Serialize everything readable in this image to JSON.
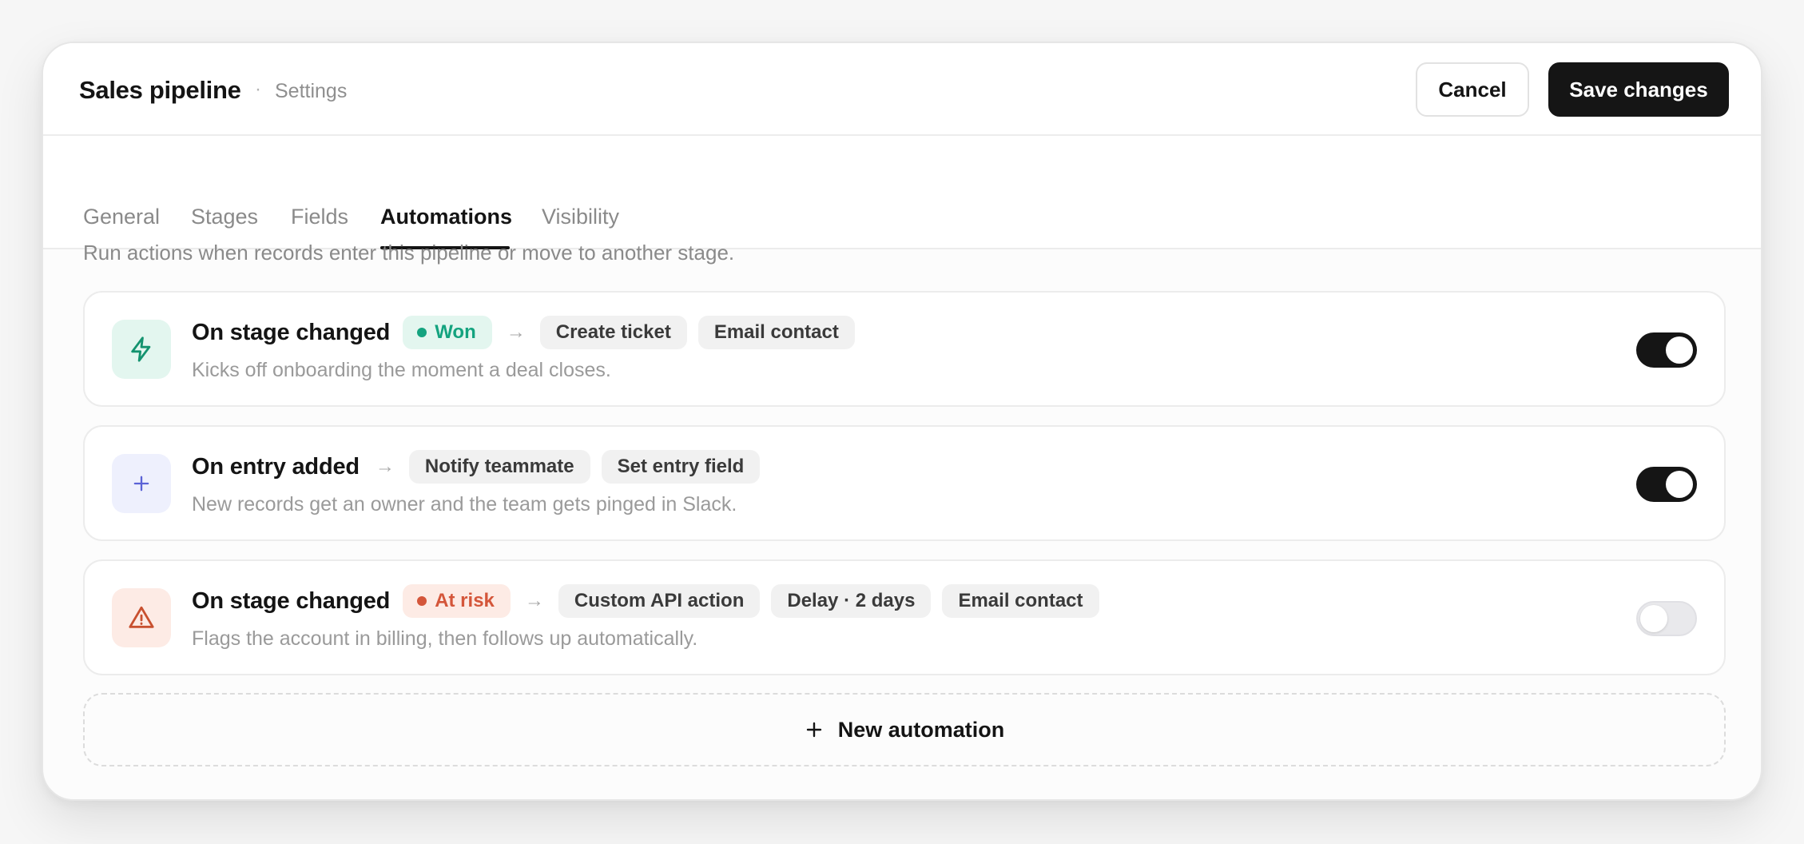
{
  "header": {
    "title": "Sales pipeline",
    "separator": "·",
    "subtitle": "Settings",
    "cancel_label": "Cancel",
    "save_label": "Save changes"
  },
  "tabs": [
    {
      "label": "General",
      "active": false
    },
    {
      "label": "Stages",
      "active": false
    },
    {
      "label": "Fields",
      "active": false
    },
    {
      "label": "Automations",
      "active": true
    },
    {
      "label": "Visibility",
      "active": false
    }
  ],
  "intro": "Run actions when records enter this pipeline or move to another stage.",
  "automations": [
    {
      "title": "On stage changed",
      "status": {
        "label": "Won",
        "color": "#14a37f",
        "background": "#e3f6ef"
      },
      "arrow": "→",
      "actions": [
        "Create ticket",
        "Email contact"
      ],
      "description": "Kicks off onboarding the moment a deal closes.",
      "icon": "lightning-icon",
      "enabled": true
    },
    {
      "title": "On entry added",
      "arrow": "→",
      "actions": [
        "Notify teammate",
        "Set entry field"
      ],
      "description": "New records get an owner and the team gets pinged in Slack.",
      "icon": "plus-icon",
      "enabled": true
    },
    {
      "title": "On stage changed",
      "status": {
        "label": "At risk",
        "color": "#d4563a",
        "background": "#fdebe5"
      },
      "arrow": "→",
      "actions": [
        "Custom API action",
        "Delay · 2 days",
        "Email contact"
      ],
      "description": "Flags the account in billing, then follows up automatically.",
      "icon": "warning-triangle-icon",
      "enabled": false
    }
  ],
  "new_automation": {
    "label": "New automation",
    "icon": "plus-icon"
  },
  "colors": {
    "primary": "#151515",
    "won": "#14a37f",
    "at_risk": "#d4563a",
    "entry_accent": "#5a62d6"
  }
}
